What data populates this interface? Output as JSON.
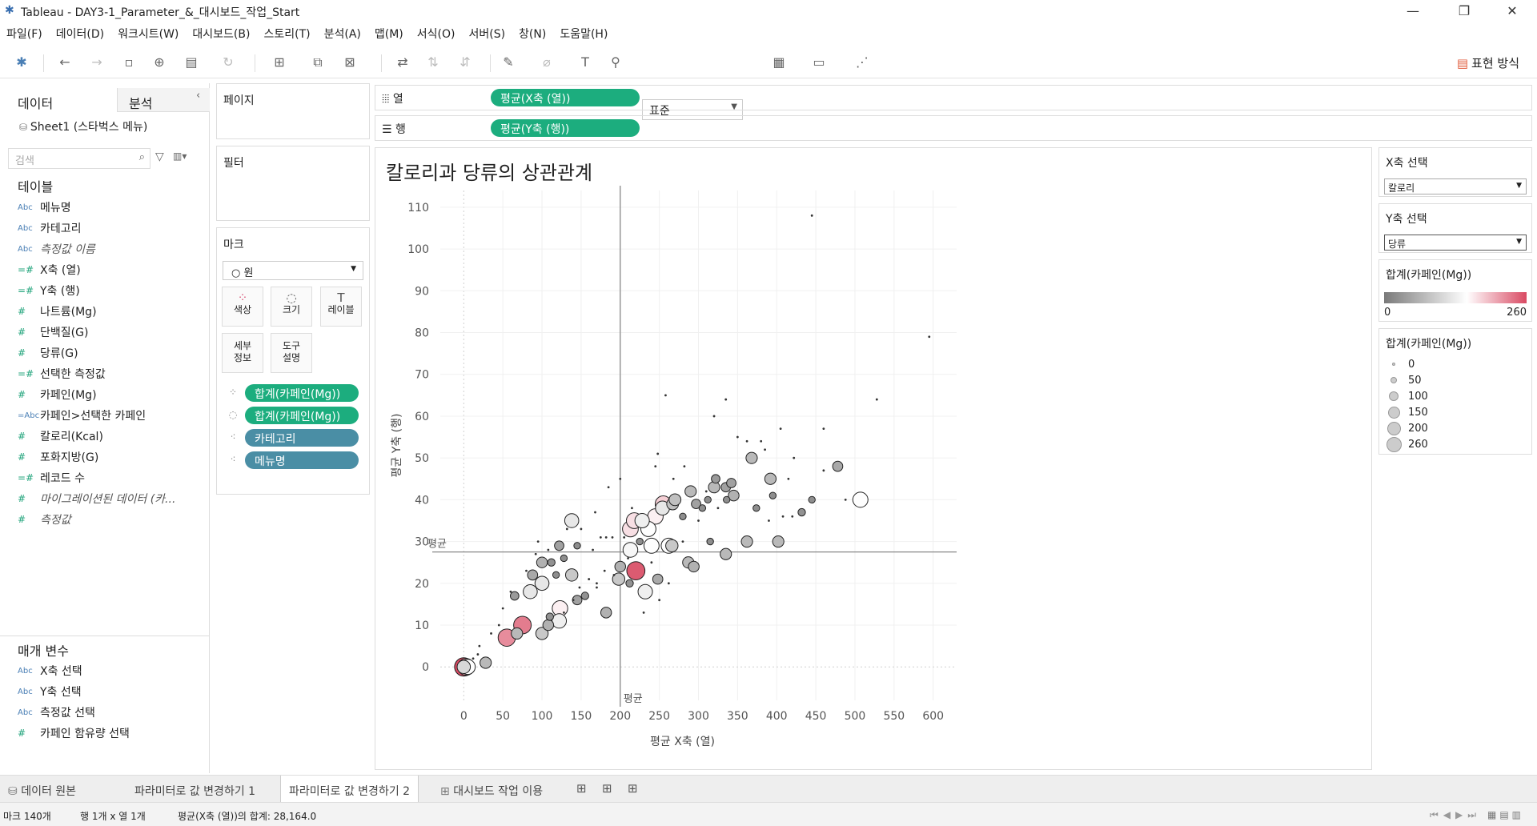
{
  "window": {
    "title": "Tableau - DAY3-1_Parameter_&_대시보드_작업_Start"
  },
  "menu": [
    "파일(F)",
    "데이터(D)",
    "워크시트(W)",
    "대시보드(B)",
    "스토리(T)",
    "분석(A)",
    "맵(M)",
    "서식(O)",
    "서버(S)",
    "창(N)",
    "도움말(H)"
  ],
  "toolbar": {
    "standard": "표준",
    "show_me": "표현 방식"
  },
  "datapane": {
    "tab_data": "데이터",
    "tab_analysis": "분석",
    "source": "Sheet1 (스타벅스 메뉴)",
    "search_placeholder": "검색",
    "tables_heading": "테이블",
    "fields": [
      {
        "type": "Abc",
        "name": "메뉴명",
        "italic": false
      },
      {
        "type": "Abc",
        "name": "카테고리",
        "italic": false
      },
      {
        "type": "Abc",
        "name": "측정값 이름",
        "italic": true
      },
      {
        "type": "=#",
        "name": "X축 (열)",
        "italic": false
      },
      {
        "type": "=#",
        "name": "Y축 (행)",
        "italic": false
      },
      {
        "type": "#",
        "name": "나트륨(Mg)",
        "italic": false
      },
      {
        "type": "#",
        "name": "단백질(G)",
        "italic": false
      },
      {
        "type": "#",
        "name": "당류(G)",
        "italic": false
      },
      {
        "type": "=#",
        "name": "선택한 측정값",
        "italic": false
      },
      {
        "type": "#",
        "name": "카페인(Mg)",
        "italic": false
      },
      {
        "type": "=Abc",
        "name": "카페인>선택한 카페인",
        "italic": false
      },
      {
        "type": "#",
        "name": "칼로리(Kcal)",
        "italic": false
      },
      {
        "type": "#",
        "name": "포화지방(G)",
        "italic": false
      },
      {
        "type": "=#",
        "name": "레코드 수",
        "italic": false
      },
      {
        "type": "#",
        "name": "마이그레이션된 데이터 (카...",
        "italic": true
      },
      {
        "type": "#",
        "name": "측정값",
        "italic": true
      }
    ],
    "params_heading": "매개 변수",
    "params": [
      {
        "type": "Abc",
        "name": "X축 선택"
      },
      {
        "type": "Abc",
        "name": "Y축 선택"
      },
      {
        "type": "Abc",
        "name": "측정값 선택"
      },
      {
        "type": "#",
        "name": "카페인 함유량 선택"
      }
    ]
  },
  "cards": {
    "pages": "페이지",
    "filters": "필터",
    "marks": "마크",
    "mark_type": "○ 원",
    "color": "색상",
    "size": "크기",
    "label": "레이블",
    "detail": "세부\n정보",
    "tooltip": "도구\n설명",
    "pills": [
      {
        "name": "합계(카페인(Mg))",
        "kind": "g",
        "icon": "color"
      },
      {
        "name": "합계(카페인(Mg))",
        "kind": "g",
        "icon": "size"
      },
      {
        "name": "카테고리",
        "kind": "b",
        "icon": "detail"
      },
      {
        "name": "메뉴명",
        "kind": "b",
        "icon": "detail"
      }
    ]
  },
  "shelves": {
    "columns_label": "열",
    "rows_label": "행",
    "columns_pill": "평균(X축 (열))",
    "rows_pill": "평균(Y축 (행))"
  },
  "legends": {
    "x_select_title": "X축 선택",
    "x_select_value": "칼로리",
    "y_select_title": "Y축 선택",
    "y_select_value": "당류",
    "color_title": "합계(카페인(Mg))",
    "color_min": "0",
    "color_max": "260",
    "size_title": "합계(카페인(Mg))",
    "size_values": [
      "0",
      "50",
      "100",
      "150",
      "200",
      "260"
    ]
  },
  "chart_data": {
    "type": "scatter",
    "title": "칼로리과 당류의 상관관계",
    "xlabel": "평균 X축 (열)",
    "ylabel": "평균 Y축 (행)",
    "xlim": [
      -30,
      630
    ],
    "ylim": [
      -8,
      114
    ],
    "xticks": [
      0,
      50,
      100,
      150,
      200,
      250,
      300,
      350,
      400,
      450,
      500,
      550,
      600
    ],
    "yticks": [
      0,
      10,
      20,
      30,
      40,
      50,
      60,
      70,
      80,
      90,
      100,
      110
    ],
    "ref_x": 200,
    "ref_y": 27.5,
    "ref_label": "평균",
    "color_range": [
      "#8a8a8a",
      "#d94a63"
    ],
    "points": [
      [
        0,
        0,
        260
      ],
      [
        3,
        0,
        200
      ],
      [
        5,
        0,
        150
      ],
      [
        0,
        0,
        100
      ],
      [
        28,
        1,
        60
      ],
      [
        55,
        7,
        220
      ],
      [
        75,
        10,
        230
      ],
      [
        68,
        8,
        60
      ],
      [
        100,
        8,
        80
      ],
      [
        108,
        10,
        50
      ],
      [
        110,
        12,
        10
      ],
      [
        122,
        11,
        130
      ],
      [
        123,
        14,
        160
      ],
      [
        145,
        16,
        30
      ],
      [
        155,
        17,
        10
      ],
      [
        85,
        18,
        120
      ],
      [
        65,
        17,
        20
      ],
      [
        100,
        20,
        120
      ],
      [
        88,
        22,
        40
      ],
      [
        118,
        22,
        5
      ],
      [
        138,
        22,
        80
      ],
      [
        100,
        25,
        50
      ],
      [
        112,
        25,
        10
      ],
      [
        128,
        26,
        5
      ],
      [
        108,
        28,
        0
      ],
      [
        122,
        29,
        30
      ],
      [
        145,
        29,
        5
      ],
      [
        138,
        35,
        120
      ],
      [
        182,
        13,
        50
      ],
      [
        198,
        21,
        80
      ],
      [
        212,
        20,
        10
      ],
      [
        200,
        24,
        50
      ],
      [
        220,
        23,
        250
      ],
      [
        232,
        18,
        130
      ],
      [
        248,
        21,
        40
      ],
      [
        213,
        28,
        140
      ],
      [
        225,
        30,
        5
      ],
      [
        240,
        29,
        150
      ],
      [
        236,
        33,
        150
      ],
      [
        213,
        33,
        170
      ],
      [
        218,
        35,
        170
      ],
      [
        228,
        35,
        130
      ],
      [
        245,
        36,
        160
      ],
      [
        254,
        38,
        120
      ],
      [
        255,
        39,
        180
      ],
      [
        267,
        39,
        70
      ],
      [
        280,
        36,
        5
      ],
      [
        270,
        40,
        70
      ],
      [
        290,
        42,
        60
      ],
      [
        297,
        39,
        30
      ],
      [
        305,
        38,
        5
      ],
      [
        312,
        40,
        5
      ],
      [
        320,
        43,
        60
      ],
      [
        322,
        45,
        20
      ],
      [
        335,
        43,
        30
      ],
      [
        345,
        41,
        50
      ],
      [
        336,
        40,
        5
      ],
      [
        325,
        38,
        0
      ],
      [
        287,
        25,
        60
      ],
      [
        294,
        24,
        50
      ],
      [
        262,
        29,
        150
      ],
      [
        266,
        29,
        80
      ],
      [
        315,
        30,
        5
      ],
      [
        335,
        27,
        60
      ],
      [
        362,
        30,
        60
      ],
      [
        402,
        30,
        60
      ],
      [
        392,
        45,
        60
      ],
      [
        368,
        50,
        60
      ],
      [
        342,
        44,
        30
      ],
      [
        374,
        38,
        5
      ],
      [
        395,
        41,
        5
      ],
      [
        408,
        36,
        0
      ],
      [
        420,
        36,
        0
      ],
      [
        432,
        37,
        10
      ],
      [
        445,
        40,
        5
      ],
      [
        460,
        47,
        0
      ],
      [
        478,
        48,
        40
      ],
      [
        488,
        40,
        0
      ],
      [
        507,
        40,
        150
      ],
      [
        405,
        57,
        0
      ],
      [
        380,
        54,
        0
      ],
      [
        362,
        54,
        0
      ],
      [
        320,
        60,
        0
      ],
      [
        335,
        64,
        0
      ],
      [
        258,
        65,
        0
      ],
      [
        445,
        108,
        0
      ],
      [
        595,
        79,
        0
      ],
      [
        528,
        64,
        0
      ],
      [
        460,
        57,
        0
      ],
      [
        422,
        50,
        0
      ],
      [
        415,
        45,
        0
      ],
      [
        385,
        52,
        0
      ],
      [
        245,
        48,
        0
      ],
      [
        282,
        48,
        0
      ],
      [
        248,
        51,
        0
      ],
      [
        200,
        45,
        0
      ],
      [
        185,
        43,
        0
      ],
      [
        168,
        37,
        0
      ],
      [
        165,
        28,
        0
      ],
      [
        175,
        31,
        0
      ],
      [
        182,
        31,
        0
      ],
      [
        190,
        31,
        0
      ],
      [
        205,
        31,
        0
      ],
      [
        192,
        22,
        0
      ],
      [
        180,
        23,
        0
      ],
      [
        148,
        19,
        0
      ],
      [
        160,
        21,
        0
      ],
      [
        170,
        20,
        0
      ],
      [
        230,
        13,
        0
      ],
      [
        250,
        16,
        0
      ],
      [
        262,
        20,
        0
      ],
      [
        280,
        30,
        0
      ],
      [
        300,
        35,
        0
      ],
      [
        310,
        42,
        0
      ],
      [
        268,
        45,
        0
      ],
      [
        150,
        33,
        0
      ],
      [
        132,
        33,
        0
      ],
      [
        95,
        30,
        0
      ],
      [
        92,
        27,
        0
      ],
      [
        80,
        23,
        0
      ],
      [
        60,
        18,
        0
      ],
      [
        50,
        14,
        0
      ],
      [
        45,
        10,
        0
      ],
      [
        35,
        8,
        0
      ],
      [
        20,
        5,
        0
      ],
      [
        18,
        3,
        0
      ],
      [
        12,
        2,
        0
      ],
      [
        140,
        16,
        0
      ],
      [
        170,
        19,
        0
      ],
      [
        128,
        13,
        0
      ],
      [
        210,
        26,
        0
      ],
      [
        240,
        25,
        0
      ],
      [
        215,
        38,
        0
      ],
      [
        350,
        55,
        0
      ],
      [
        390,
        35,
        0
      ]
    ]
  },
  "sheet_tabs": [
    "데이터 원본",
    "파라미터로 값 변경하기 1",
    "파라미터로 값 변경하기 2",
    "대시보드 작업 이용"
  ],
  "active_tab": 2,
  "status": {
    "marks": "마크 140개",
    "rowscols": "행 1개 x 열 1개",
    "sum": "평균(X축 (열))의 합계: 28,164.0"
  }
}
